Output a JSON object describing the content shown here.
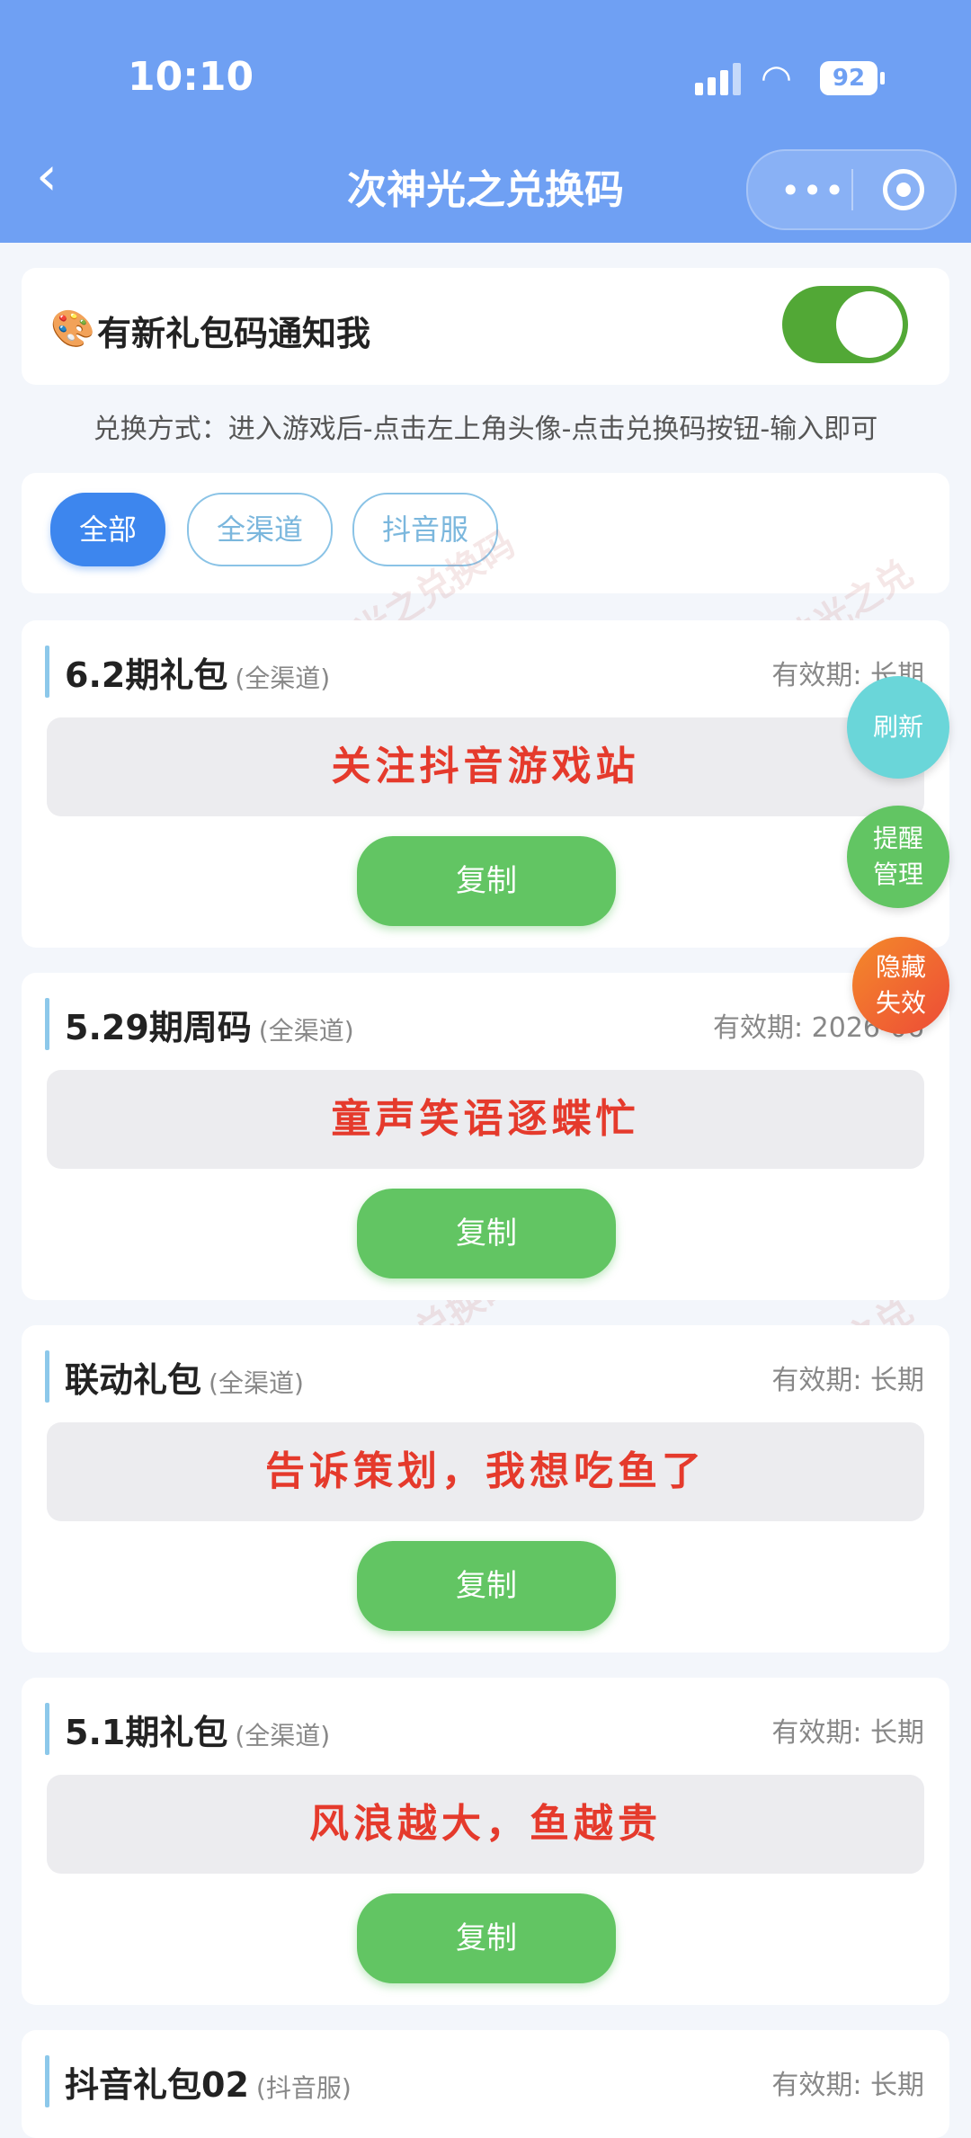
{
  "status_bar": {
    "time": "10:10",
    "battery": "92"
  },
  "header": {
    "title": "次神光之兑换码"
  },
  "notify": {
    "icon": "🎨",
    "label": "有新礼包码通知我",
    "enabled": true
  },
  "howto": "兑换方式：进入游戏后-点击左上角头像-点击兑换码按钮-输入即可",
  "filters": [
    {
      "label": "全部",
      "active": true
    },
    {
      "label": "全渠道",
      "active": false
    },
    {
      "label": "抖音服",
      "active": false
    }
  ],
  "cards": [
    {
      "name": "6.2期礼包",
      "channel": "(全渠道)",
      "valid": "有效期: 长期",
      "code": "关注抖音游戏站",
      "copy": "复制"
    },
    {
      "name": "5.29期周码",
      "channel": "(全渠道)",
      "valid": "有效期: 2026-06",
      "code": "童声笑语逐蝶忙",
      "copy": "复制"
    },
    {
      "name": "联动礼包",
      "channel": "(全渠道)",
      "valid": "有效期: 长期",
      "code": "告诉策划，我想吃鱼了",
      "copy": "复制"
    },
    {
      "name": "5.1期礼包",
      "channel": "(全渠道)",
      "valid": "有效期: 长期",
      "code": "风浪越大，鱼越贵",
      "copy": "复制"
    },
    {
      "name": "抖音礼包02",
      "channel": "(抖音服)",
      "valid": "有效期: 长期"
    }
  ],
  "fabs": {
    "refresh": "刷新",
    "remind_1": "提醒",
    "remind_2": "管理",
    "hide_1": "隐藏",
    "hide_2": "失效"
  },
  "watermark": "微信小程序 次神光之兑换码"
}
